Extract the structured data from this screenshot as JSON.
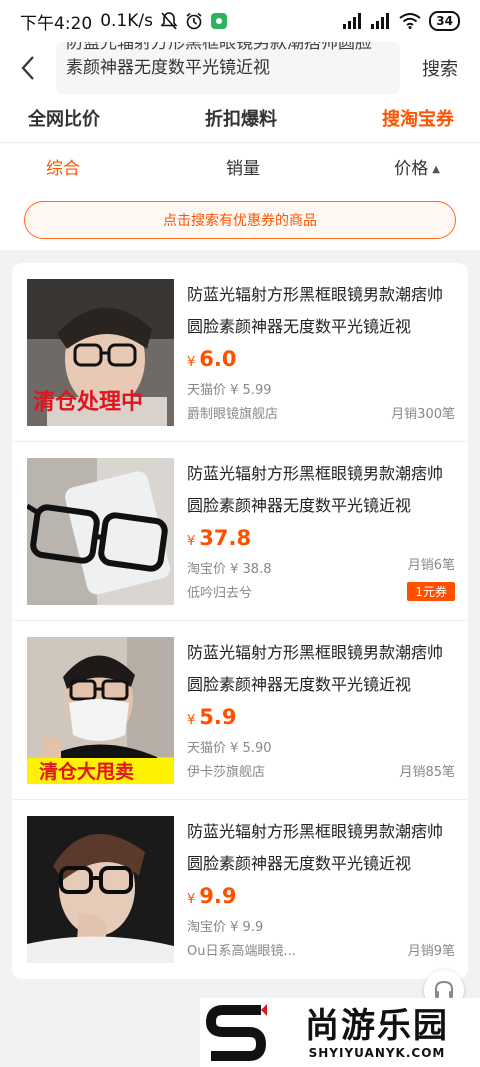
{
  "status_bar": {
    "time": "下午4:20",
    "speed": "0.1K/s",
    "battery": "34"
  },
  "header": {
    "search_line1": "防蓝光辐射方形黑框眼镜男款潮痞帅圆脸",
    "search_line2": "素颜神器无度数平光镜近视",
    "search_button": "搜索"
  },
  "tabs": [
    {
      "label": "全网比价"
    },
    {
      "label": "折扣爆料"
    },
    {
      "label": "搜淘宝券"
    }
  ],
  "sort": [
    {
      "label": "综合"
    },
    {
      "label": "销量"
    },
    {
      "label": "价格"
    }
  ],
  "coupon_banner": "点击搜索有优惠券的商品",
  "products": [
    {
      "title": "防蓝光辐射方形黑框眼镜男款潮痞帅圆脸素颜神器无度数平光镜近视",
      "currency": "¥",
      "price": "6.0",
      "ref_price": "天猫价 ¥ 5.99",
      "shop": "爵制眼镜旗舰店",
      "sales": "月销300笔",
      "overlay": "清仓处理中"
    },
    {
      "title": "防蓝光辐射方形黑框眼镜男款潮痞帅圆脸素颜神器无度数平光镜近视",
      "currency": "¥",
      "price": "37.8",
      "ref_price": "淘宝价 ¥ 38.8",
      "shop": "低吟归去兮",
      "sales": "月销6笔",
      "coupon": "1元券"
    },
    {
      "title": "防蓝光辐射方形黑框眼镜男款潮痞帅圆脸素颜神器无度数平光镜近视",
      "currency": "¥",
      "price": "5.9",
      "ref_price": "天猫价 ¥ 5.90",
      "shop": "伊卡莎旗舰店",
      "sales": "月销85笔",
      "overlay": "清仓大甩卖"
    },
    {
      "title": "防蓝光辐射方形黑框眼镜男款潮痞帅圆脸素颜神器无度数平光镜近视",
      "currency": "¥",
      "price": "9.9",
      "ref_price": "淘宝价 ¥ 9.9",
      "shop": "Ou日系高端眼镜...",
      "sales": "月销9笔"
    }
  ],
  "watermark": {
    "name": "尚游乐园",
    "domain": "SHYIYUANYK.COM"
  },
  "colors": {
    "accent": "#ff5500",
    "price": "#ff5000"
  }
}
